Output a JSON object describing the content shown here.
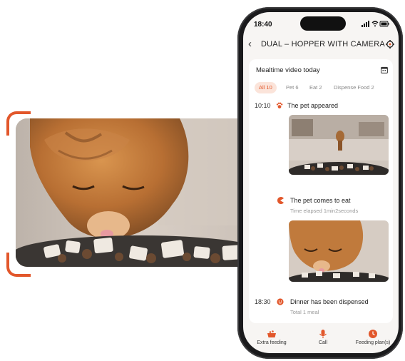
{
  "status_bar": {
    "time": "18:40"
  },
  "header": {
    "title": "DUAL – HOPPER WITH CAMERA"
  },
  "panel": {
    "title": "Mealtime video today",
    "filters": [
      {
        "label": "All 10",
        "active": true
      },
      {
        "label": "Pet 6",
        "active": false
      },
      {
        "label": "Eat 2",
        "active": false
      },
      {
        "label": "Dispense Food 2",
        "active": false
      }
    ]
  },
  "events": [
    {
      "time": "10:10",
      "title": "The pet appeared",
      "subtitle": "",
      "icon": "paw-icon"
    },
    {
      "time": "",
      "title": "The pet comes to eat",
      "subtitle": "Time elapsed 1min2seconds",
      "icon": "eating-icon"
    },
    {
      "time": "18:30",
      "title": "Dinner has been dispensed",
      "subtitle": "Total 1 meal",
      "icon": "smile-icon"
    }
  ],
  "bottom_tabs": [
    {
      "label": "Extra feeding",
      "icon": "bowl-icon"
    },
    {
      "label": "Call",
      "icon": "microphone-icon"
    },
    {
      "label": "Feeding plan(s)",
      "icon": "feeding-plan-icon"
    }
  ],
  "colors": {
    "accent": "#e2572b",
    "chip_bg": "#fbe4da"
  }
}
